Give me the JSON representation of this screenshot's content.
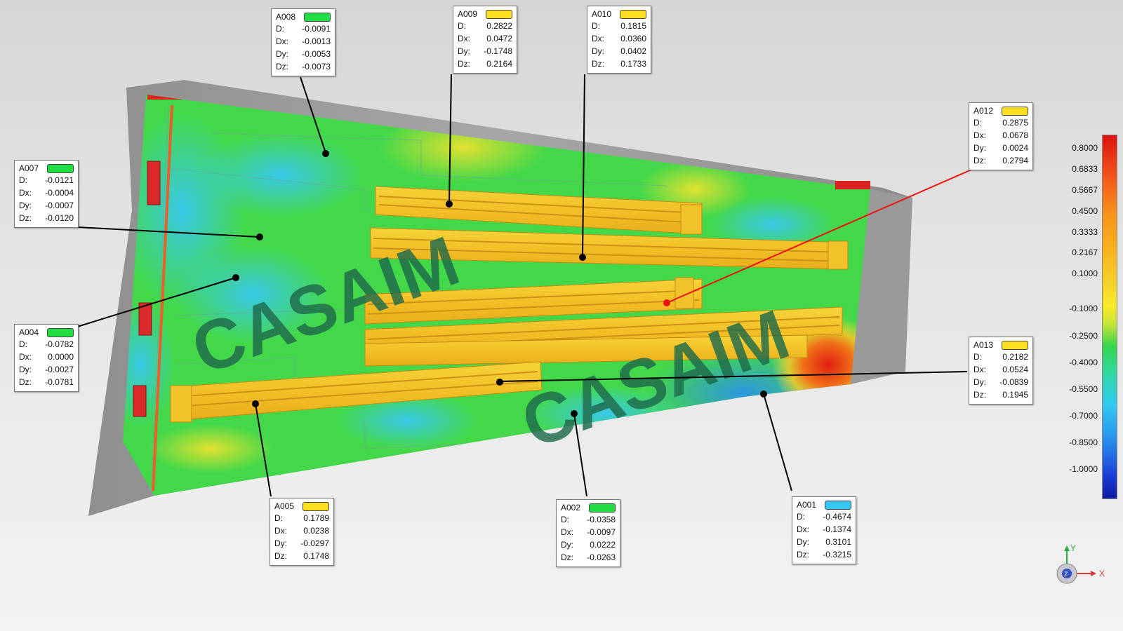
{
  "watermark": {
    "text_1": "CASAIM",
    "text_2": "CASAIM"
  },
  "callouts": [
    {
      "id": "A008",
      "swatch_color": "#22dd44",
      "labels": [
        "D:",
        "Dx:",
        "Dy:",
        "Dz:"
      ],
      "values": [
        "-0.0091",
        "-0.0013",
        "-0.0053",
        "-0.0073"
      ]
    },
    {
      "id": "A009",
      "swatch_color": "#ffe020",
      "labels": [
        "D:",
        "Dx:",
        "Dy:",
        "Dz:"
      ],
      "values": [
        "0.2822",
        "0.0472",
        "-0.1748",
        "0.2164"
      ]
    },
    {
      "id": "A010",
      "swatch_color": "#ffe020",
      "labels": [
        "D:",
        "Dx:",
        "Dy:",
        "Dz:"
      ],
      "values": [
        "0.1815",
        "0.0360",
        "0.0402",
        "0.1733"
      ]
    },
    {
      "id": "A012",
      "swatch_color": "#ffe020",
      "labels": [
        "D:",
        "Dx:",
        "Dy:",
        "Dz:"
      ],
      "values": [
        "0.2875",
        "0.0678",
        "0.0024",
        "0.2794"
      ]
    },
    {
      "id": "A007",
      "swatch_color": "#22dd44",
      "labels": [
        "D:",
        "Dx:",
        "Dy:",
        "Dz:"
      ],
      "values": [
        "-0.0121",
        "-0.0004",
        "-0.0007",
        "-0.0120"
      ]
    },
    {
      "id": "A004",
      "swatch_color": "#22dd44",
      "labels": [
        "D:",
        "Dx:",
        "Dy:",
        "Dz:"
      ],
      "values": [
        "-0.0782",
        "0.0000",
        "-0.0027",
        "-0.0781"
      ]
    },
    {
      "id": "A013",
      "swatch_color": "#ffe020",
      "labels": [
        "D:",
        "Dx:",
        "Dy:",
        "Dz:"
      ],
      "values": [
        "0.2182",
        "0.0524",
        "-0.0839",
        "0.1945"
      ]
    },
    {
      "id": "A005",
      "swatch_color": "#ffe020",
      "labels": [
        "D:",
        "Dx:",
        "Dy:",
        "Dz:"
      ],
      "values": [
        "0.1789",
        "0.0238",
        "-0.0297",
        "0.1748"
      ]
    },
    {
      "id": "A002",
      "swatch_color": "#22dd44",
      "labels": [
        "D:",
        "Dx:",
        "Dy:",
        "Dz:"
      ],
      "values": [
        "-0.0358",
        "-0.0097",
        "0.0222",
        "-0.0263"
      ]
    },
    {
      "id": "A001",
      "swatch_color": "#35c6f4",
      "labels": [
        "D:",
        "Dx:",
        "Dy:",
        "Dz:"
      ],
      "values": [
        "-0.4674",
        "-0.1374",
        "0.3101",
        "-0.3215"
      ]
    }
  ],
  "legend": {
    "labels": [
      "0.8000",
      "0.6833",
      "0.5667",
      "0.4500",
      "0.3333",
      "0.2167",
      "0.1000",
      "-0.1000",
      "-0.2500",
      "-0.4000",
      "-0.5500",
      "-0.7000",
      "-0.8500",
      "-1.0000"
    ],
    "colors": [
      "#dd1111",
      "#f25a1a",
      "#f7941d",
      "#f9b41f",
      "#f6cf2a",
      "#f9ea2a",
      "#c7e43a",
      "#38d64c",
      "#2fd8a9",
      "#33c9ee",
      "#2a9cf0",
      "#2465e0",
      "#1a3ad6",
      "#0e1aa0"
    ]
  },
  "triad": {
    "y_label": "Y",
    "x_label": "X",
    "z_label": "Z"
  }
}
